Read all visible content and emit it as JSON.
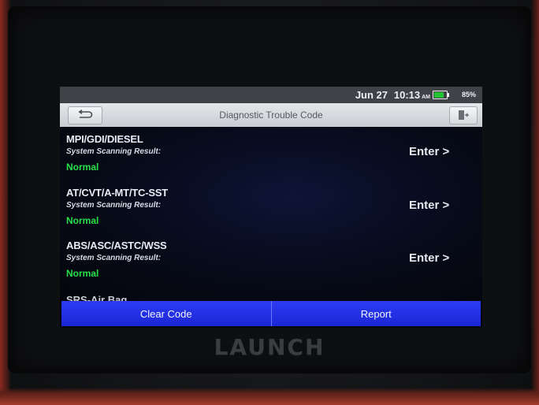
{
  "status_bar": {
    "date": "Jun 27",
    "time": "10:13",
    "ampm": "AM",
    "battery": "85%",
    "battery_color": "#22c434"
  },
  "header": {
    "title": "Diagnostic Trouble Code",
    "back_icon": "back-arrow-icon",
    "exit_icon": "exit-door-icon"
  },
  "systems": [
    {
      "name": "MPI/GDI/DIESEL",
      "result_label": "System Scanning Result:",
      "status": "Normal",
      "action": "Enter >"
    },
    {
      "name": "AT/CVT/A-MT/TC-SST",
      "result_label": "System Scanning Result:",
      "status": "Normal",
      "action": "Enter >"
    },
    {
      "name": "ABS/ASC/ASTC/WSS",
      "result_label": "System Scanning Result:",
      "status": "Normal",
      "action": "Enter >"
    }
  ],
  "partial_row": "SRS-Air Bag",
  "footer": {
    "clear_code": "Clear Code",
    "report": "Report"
  },
  "device": {
    "brand": "LAUNCH"
  },
  "colors": {
    "status_normal": "#27e04a",
    "button_blue": "#1f2ce6"
  }
}
